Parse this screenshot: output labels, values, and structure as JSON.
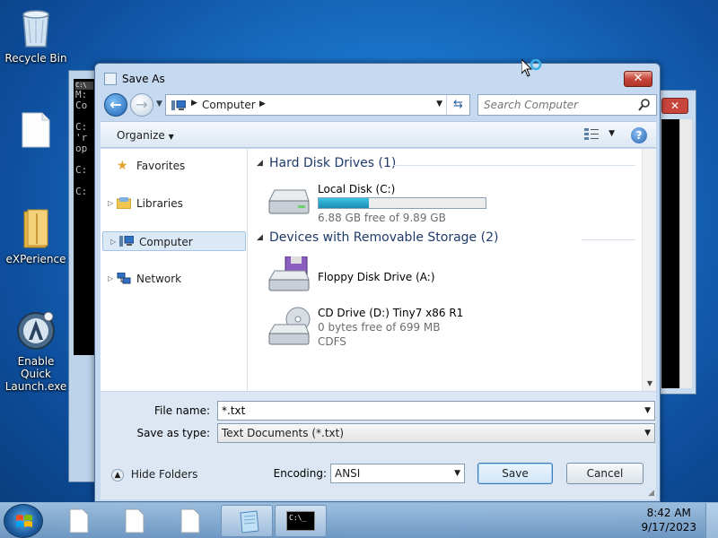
{
  "desktop": {
    "icons": [
      {
        "label": "Recycle Bin",
        "icon": "recycle-bin-icon"
      },
      {
        "label": "",
        "icon": "blank-document-icon"
      },
      {
        "label": "eXPerience",
        "icon": "folder-icon"
      },
      {
        "label": "Enable Quick Launch.exe",
        "icon": "quick-launch-icon"
      }
    ]
  },
  "console": {
    "lines": [
      "M:",
      "Co",
      "",
      "C:",
      "'r",
      "op",
      "",
      "C:",
      "",
      "C:"
    ],
    "title_icon_text": "C:\\"
  },
  "dialog": {
    "title": "Save As",
    "close_label": "✕",
    "address": {
      "crumb": "Computer"
    },
    "search": {
      "placeholder": "Search Computer"
    },
    "toolbar": {
      "organize_label": "Organize",
      "help_label": "?"
    },
    "nav": {
      "favorites": "Favorites",
      "libraries": "Libraries",
      "computer": "Computer",
      "network": "Network"
    },
    "groups": {
      "hard_disk": "Hard Disk Drives (1)",
      "removable": "Devices with Removable Storage (2)"
    },
    "drives": {
      "local": {
        "name": "Local Disk (C:)",
        "free": "6.88 GB free of 9.89 GB",
        "used_fraction": 0.3
      },
      "floppy": {
        "name": "Floppy Disk Drive (A:)"
      },
      "cd": {
        "name": "CD Drive (D:) Tiny7 x86 R1",
        "free": "0 bytes free of 699 MB",
        "fs": "CDFS"
      }
    },
    "form": {
      "filename_label": "File name:",
      "filename_value": "*.txt",
      "type_label": "Save as type:",
      "type_value": "Text Documents (*.txt)",
      "hide_folders": "Hide Folders",
      "encoding_label": "Encoding:",
      "encoding_value": "ANSI",
      "save_label": "Save",
      "cancel_label": "Cancel"
    }
  },
  "taskbar": {
    "time": "8:42 AM",
    "date": "9/17/2023",
    "console_glyph": "C:\\_"
  }
}
